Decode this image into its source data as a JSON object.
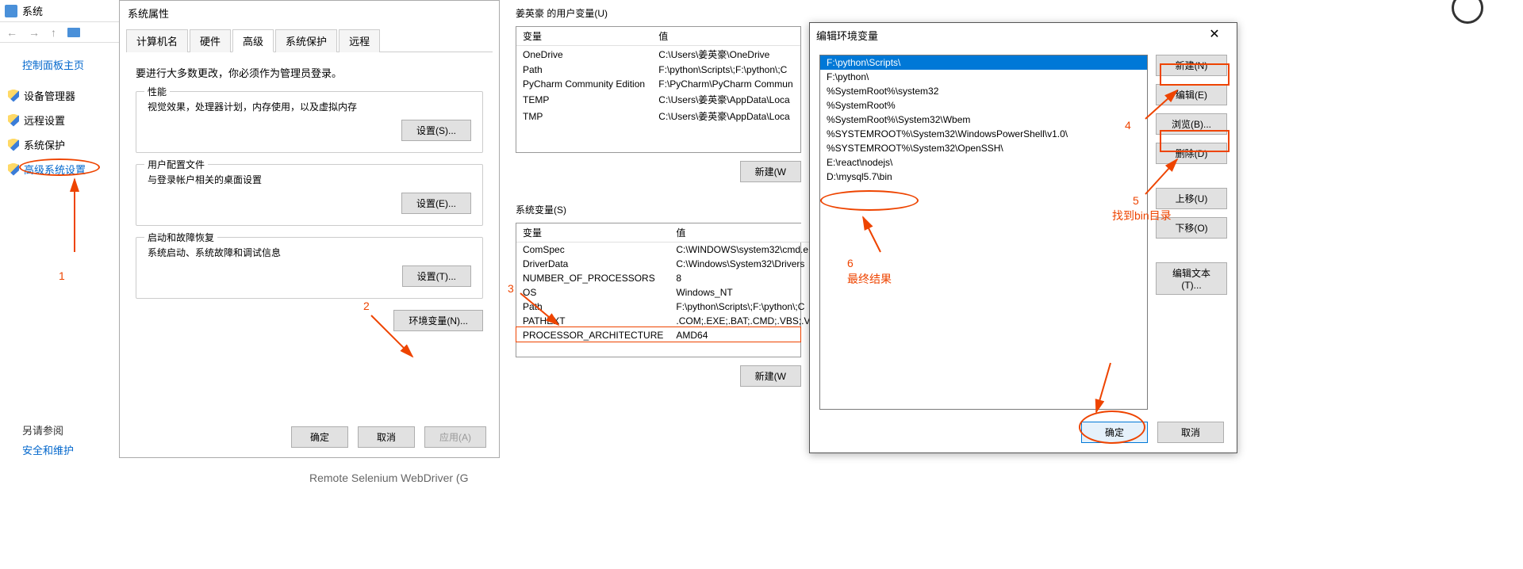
{
  "cp": {
    "title": "系统",
    "main_link": "控制面板主页",
    "links": [
      "设备管理器",
      "远程设置",
      "系统保护",
      "高级系统设置"
    ],
    "bottom_label": "另请参阅",
    "bottom_link": "安全和维护"
  },
  "sysprops": {
    "title": "系统属性",
    "tabs": [
      "计算机名",
      "硬件",
      "高级",
      "系统保护",
      "远程"
    ],
    "note": "要进行大多数更改，你必须作为管理员登录。",
    "groups": [
      {
        "title": "性能",
        "desc": "视觉效果，处理器计划，内存使用，以及虚拟内存",
        "btn": "设置(S)..."
      },
      {
        "title": "用户配置文件",
        "desc": "与登录帐户相关的桌面设置",
        "btn": "设置(E)..."
      },
      {
        "title": "启动和故障恢复",
        "desc": "系统启动、系统故障和调试信息",
        "btn": "设置(T)..."
      }
    ],
    "env_btn": "环境变量(N)...",
    "ok": "确定",
    "cancel": "取消",
    "apply": "应用(A)"
  },
  "envvars": {
    "user_title": "姜英豪 的用户变量(U)",
    "sys_title": "系统变量(S)",
    "col_var": "变量",
    "col_val": "值",
    "user_rows": [
      {
        "v": "OneDrive",
        "val": "C:\\Users\\姜英豪\\OneDrive"
      },
      {
        "v": "Path",
        "val": "F:\\python\\Scripts\\;F:\\python\\;C"
      },
      {
        "v": "PyCharm Community Edition",
        "val": "F:\\PyCharm\\PyCharm Commun"
      },
      {
        "v": "TEMP",
        "val": "C:\\Users\\姜英豪\\AppData\\Loca"
      },
      {
        "v": "TMP",
        "val": "C:\\Users\\姜英豪\\AppData\\Loca"
      }
    ],
    "sys_rows": [
      {
        "v": "ComSpec",
        "val": "C:\\WINDOWS\\system32\\cmd.e"
      },
      {
        "v": "DriverData",
        "val": "C:\\Windows\\System32\\Drivers"
      },
      {
        "v": "NUMBER_OF_PROCESSORS",
        "val": "8"
      },
      {
        "v": "OS",
        "val": "Windows_NT"
      },
      {
        "v": "Path",
        "val": "F:\\python\\Scripts\\;F:\\python\\;C"
      },
      {
        "v": "PATHEXT",
        "val": ".COM;.EXE;.BAT;.CMD;.VBS;.VB"
      },
      {
        "v": "PROCESSOR_ARCHITECTURE",
        "val": "AMD64"
      }
    ],
    "new_btn": "新建(W"
  },
  "editenv": {
    "title": "编辑环境变量",
    "items": [
      "F:\\python\\Scripts\\",
      "F:\\python\\",
      "%SystemRoot%\\system32",
      "%SystemRoot%",
      "%SystemRoot%\\System32\\Wbem",
      "%SYSTEMROOT%\\System32\\WindowsPowerShell\\v1.0\\",
      "%SYSTEMROOT%\\System32\\OpenSSH\\",
      "E:\\react\\nodejs\\",
      "D:\\mysql5.7\\bin"
    ],
    "btns": {
      "new": "新建(N)",
      "edit": "编辑(E)",
      "browse": "浏览(B)...",
      "delete": "删除(D)",
      "up": "上移(U)",
      "down": "下移(O)",
      "edittext": "编辑文本(T)..."
    },
    "ok": "确定",
    "cancel": "取消"
  },
  "anno": {
    "n1": "1",
    "n2": "2",
    "n3": "3",
    "n4": "4",
    "n5": "5",
    "n6": "6",
    "t5": "找到bin目录",
    "t6": "最终结果"
  },
  "bottom": "Remote Selenium WebDriver (G"
}
